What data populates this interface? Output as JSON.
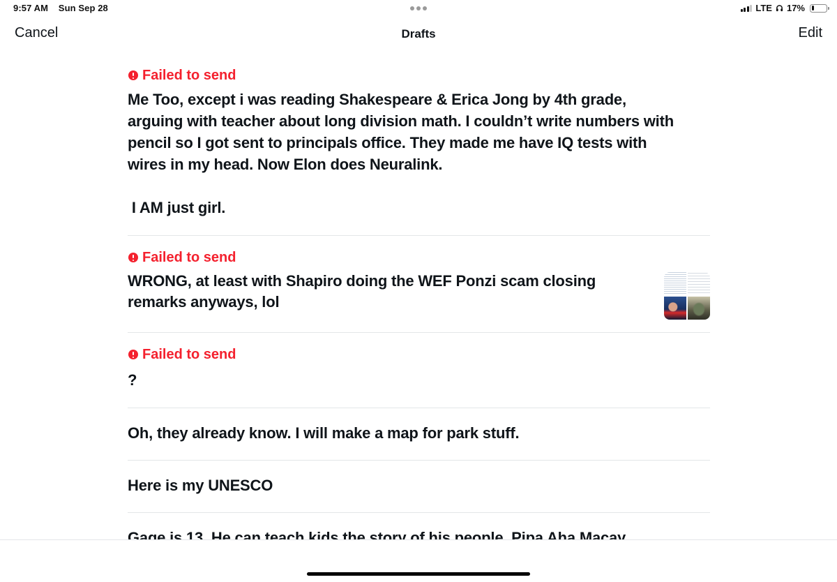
{
  "status_bar": {
    "time": "9:57 AM",
    "date": "Sun Sep 28",
    "network": "LTE",
    "battery_percent_label": "17%",
    "battery_level": 0.17
  },
  "nav": {
    "cancel_label": "Cancel",
    "title": "Drafts",
    "edit_label": "Edit"
  },
  "drafts": [
    {
      "failed": true,
      "failed_label": "Failed to send",
      "text": "Me Too, except i was reading Shakespeare & Erica Jong by 4th grade,\narguing with teacher about long division math. I couldn’t write numbers with\npencil so I got sent to principals office. They made me have IQ tests with\nwires in my head. Now Elon does Neuralink.\n\n I AM just girl."
    },
    {
      "failed": true,
      "failed_label": "Failed to send",
      "text": "WRONG, at least with Shapiro doing the WEF Ponzi scam closing\nremarks anyways, lol",
      "has_media": true
    },
    {
      "failed": true,
      "failed_label": "Failed to send",
      "text": "?"
    },
    {
      "failed": false,
      "text": "Oh, they already know. I will make a map for park stuff."
    },
    {
      "failed": false,
      "text": "Here is my UNESCO"
    },
    {
      "failed": false,
      "text": "Gage is 13. He can teach kids the story of his people. Pipa Aha Macay"
    }
  ],
  "colors": {
    "error": "#f4212e",
    "text": "#0f1419",
    "divider": "#e3e6e8"
  }
}
